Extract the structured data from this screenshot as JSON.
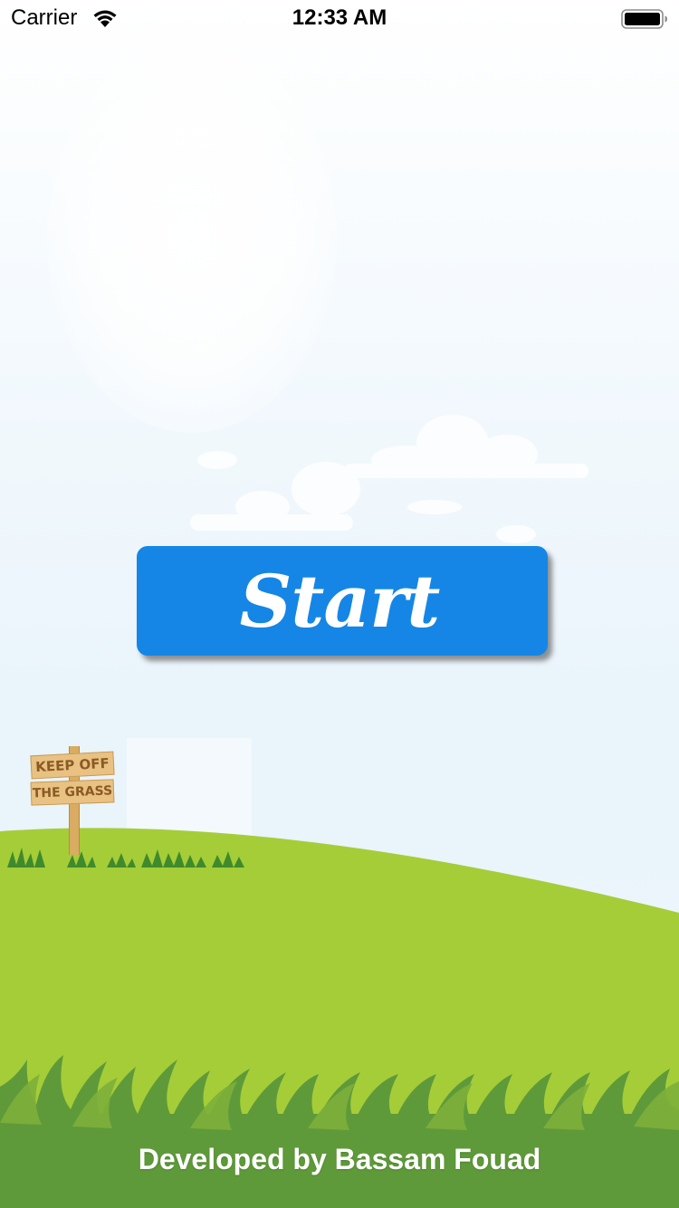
{
  "status_bar": {
    "carrier": "Carrier",
    "time": "12:33 AM",
    "wifi_icon": "wifi-icon",
    "battery_icon": "battery-full-icon"
  },
  "start_button": {
    "label": "Start"
  },
  "sign": {
    "line1": "KEEP OFF",
    "line2": "THE GRASS"
  },
  "footer": {
    "credit": "Developed by Bassam Fouad"
  },
  "colors": {
    "button": "#1586e6",
    "grass_light": "#a5cd38",
    "grass_dark": "#5f9a3a",
    "sky": "#eef6fb"
  }
}
